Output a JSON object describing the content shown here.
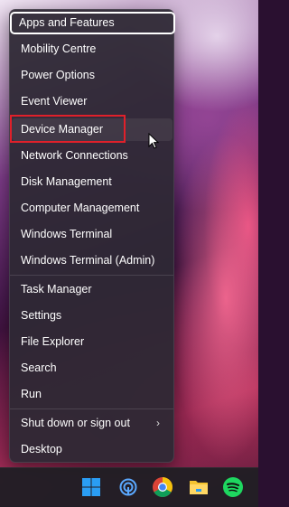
{
  "context_menu": {
    "items": [
      {
        "label": "Apps and Features"
      },
      {
        "label": "Mobility Centre"
      },
      {
        "label": "Power Options"
      },
      {
        "label": "Event Viewer"
      },
      {
        "label": "Device Manager"
      },
      {
        "label": "Network Connections"
      },
      {
        "label": "Disk Management"
      },
      {
        "label": "Computer Management"
      },
      {
        "label": "Windows Terminal"
      },
      {
        "label": "Windows Terminal (Admin)"
      },
      {
        "label": "Task Manager"
      },
      {
        "label": "Settings"
      },
      {
        "label": "File Explorer"
      },
      {
        "label": "Search"
      },
      {
        "label": "Run"
      },
      {
        "label": "Shut down or sign out"
      },
      {
        "label": "Desktop"
      }
    ],
    "submenu_arrow": "›"
  },
  "taskbar": {
    "icons": [
      "windows-start-icon",
      "hotspot-icon",
      "chrome-icon",
      "file-explorer-icon",
      "spotify-icon"
    ]
  },
  "colors": {
    "highlight_box": "#e0202a",
    "menu_bg": "#2e2834",
    "taskbar_bg": "#201e24",
    "windows_blue": "#2a9df4",
    "spotify_green": "#1ed760",
    "folder_yellow": "#f4c430"
  }
}
